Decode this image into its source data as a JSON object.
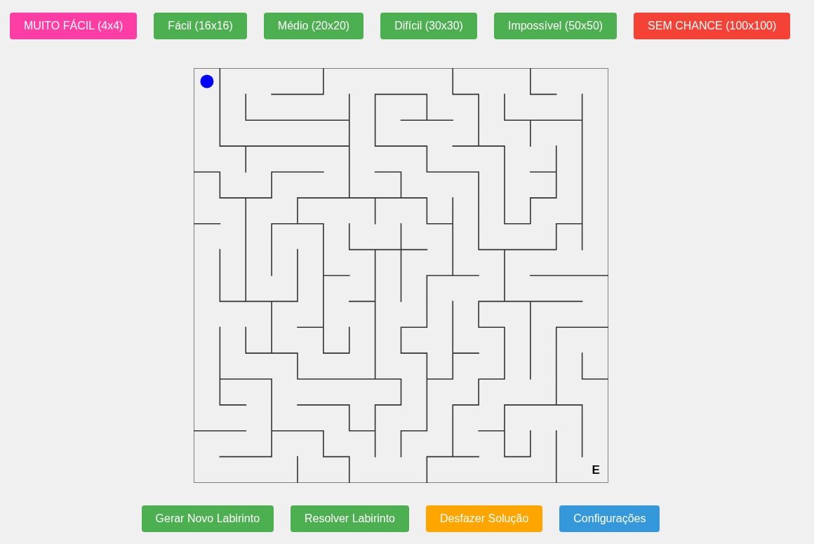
{
  "difficulty_buttons": [
    {
      "label": "MUITO FÁCIL (4x4)",
      "color": "#ff3ea5"
    },
    {
      "label": "Fácil (16x16)",
      "color": "#4caf50"
    },
    {
      "label": "Médio (20x20)",
      "color": "#4caf50"
    },
    {
      "label": "Difícil (30x30)",
      "color": "#4caf50"
    },
    {
      "label": "Impossível (50x50)",
      "color": "#4caf50"
    },
    {
      "label": "SEM CHANCE (100x100)",
      "color": "#f44336"
    }
  ],
  "maze": {
    "exit_label": "E"
  },
  "action_buttons": [
    {
      "label": "Gerar Novo Labirinto",
      "color": "#4caf50"
    },
    {
      "label": "Resolver Labirinto",
      "color": "#4caf50"
    },
    {
      "label": "Desfazer Solução",
      "color": "#ffa500"
    },
    {
      "label": "Configurações",
      "color": "#3498db"
    }
  ]
}
